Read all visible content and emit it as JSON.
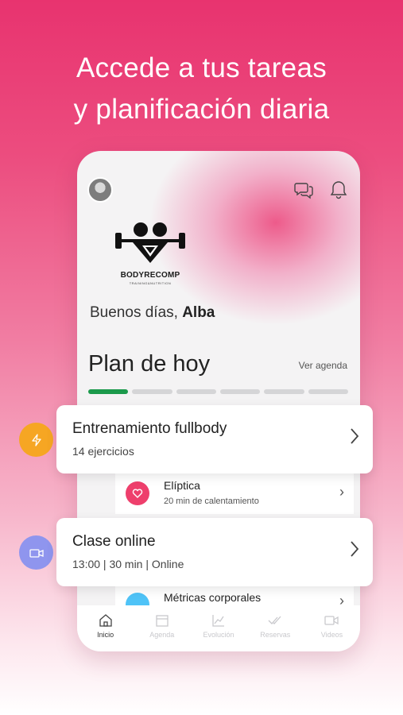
{
  "headline": {
    "line1": "Accede a tus tareas",
    "line2": "y planificación diaria"
  },
  "header": {
    "avatar_icon": "user-avatar",
    "chat_icon": "chat-bubbles-icon",
    "bell_icon": "bell-icon"
  },
  "logo": {
    "brand": "BODYRECOMP",
    "tagline": "TRAINING&NUTRITION"
  },
  "greeting": {
    "prefix": "Buenos días,",
    "name": "Alba"
  },
  "plan": {
    "title": "Plan de hoy",
    "agenda_link": "Ver agenda",
    "progress_completed": 1,
    "progress_total": 6
  },
  "cards": [
    {
      "title": "Entrenamiento fullbody",
      "subtitle": "14 ejercicios",
      "icon": "lightning-icon",
      "color": "#f6a623"
    },
    {
      "title": "Clase online",
      "subtitle": "13:00 | 30 min | Online",
      "icon": "video-icon",
      "color": "#8f95ee"
    }
  ],
  "rows": [
    {
      "title": "Elíptica",
      "subtitle": "20 min de calentamiento",
      "icon": "heart-icon",
      "color": "#ee3f6c"
    },
    {
      "title": "Métricas corporales",
      "subtitle": "",
      "icon": "metrics-icon",
      "color": "#4fc3f7"
    }
  ],
  "nav": [
    {
      "label": "Inicio",
      "icon": "home-icon",
      "active": true
    },
    {
      "label": "Agenda",
      "icon": "calendar-icon",
      "active": false
    },
    {
      "label": "Evolución",
      "icon": "chart-icon",
      "active": false
    },
    {
      "label": "Reservas",
      "icon": "check-icon",
      "active": false
    },
    {
      "label": "Videos",
      "icon": "video-icon",
      "active": false
    }
  ]
}
